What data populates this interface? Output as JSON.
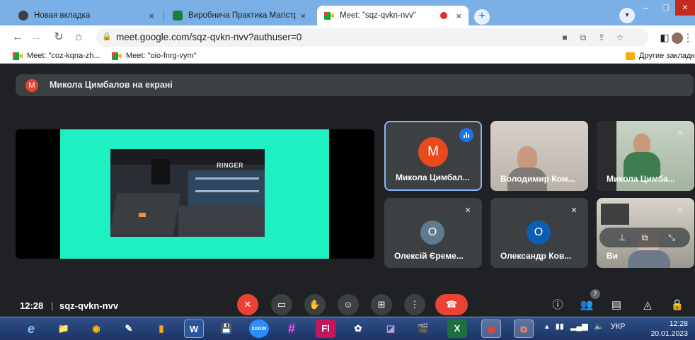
{
  "browser": {
    "tabs": [
      {
        "title": "Новая вкладка",
        "close": "×",
        "favicon_color": "#3c4043"
      },
      {
        "title": "Виробнича Практика Магістрі",
        "close": "×",
        "favicon_color": "#188038"
      },
      {
        "title": "Meet: \"sqz-qvkn-nvv\"",
        "close": "×",
        "favicon_color": "#00ac47"
      }
    ],
    "new_tab": "+",
    "window_controls": {
      "minimize": "–",
      "maximize": "□",
      "close": "×"
    },
    "url": "meet.google.com/sqz-qvkn-nvv?authuser=0",
    "bookmarks": [
      {
        "label": "Meet: \"coz-kqna-zh..."
      },
      {
        "label": "Meet: \"oio-fnrg-vym\""
      }
    ],
    "other_bookmarks": "Другие закладки"
  },
  "meet": {
    "presenter": {
      "initial": "M",
      "text": "Микола Цимбалов на екрані"
    },
    "shared_screen_banner": "RINGER",
    "participants": [
      {
        "name": "Микола Цимбал...",
        "initial": "M",
        "avatar_color": "#e8491d",
        "speaking": true
      },
      {
        "name": "Володимир Ком...",
        "video": true,
        "muted": false
      },
      {
        "name": "Микола Цимба...",
        "video": true,
        "muted": true
      },
      {
        "name": "Олексій Єреме...",
        "initial": "O",
        "avatar_color": "#5f7b8c",
        "muted": true
      },
      {
        "name": "Олександр Ков...",
        "initial": "O",
        "avatar_color": "#0a5fb4",
        "muted": true
      },
      {
        "name": "Ви",
        "video": true,
        "muted": true
      }
    ],
    "time": "12:28",
    "divider": "|",
    "meeting_code": "sqz-qvkn-nvv",
    "participant_count": "7"
  },
  "taskbar": {
    "items": [
      "e",
      "📁",
      "◉",
      "✎",
      "▮",
      "W",
      "💾",
      "zoom",
      "#",
      "Fl",
      "✿",
      "◪",
      "🎬",
      "X",
      "◉",
      "⧉"
    ],
    "language": "УКР",
    "time": "12:28",
    "date": "20.01.2023"
  },
  "colors": {
    "meet_bg": "#202124",
    "tile_bg": "#3c4043",
    "accent_red": "#ea4335",
    "screen_teal": "#1ff0c4",
    "speaking_border": "#8ab4f8",
    "chrome_frame": "#7ab0e6"
  }
}
